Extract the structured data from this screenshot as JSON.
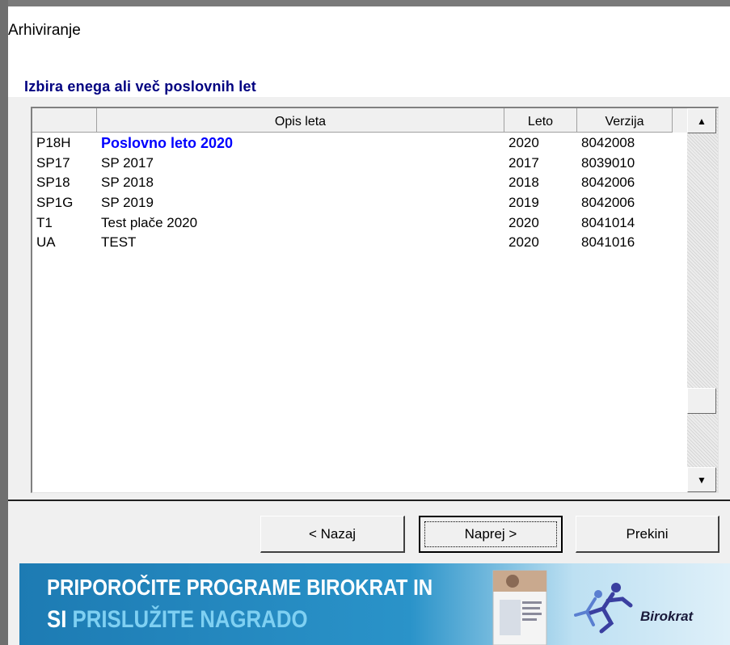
{
  "window": {
    "title": "Arhiviranje"
  },
  "section": {
    "title": "Izbira enega ali več poslovnih let"
  },
  "grid": {
    "columns": [
      "",
      "Opis leta",
      "Leto",
      "Verzija"
    ],
    "rows": [
      {
        "code": "P18H",
        "desc": "Poslovno leto 2020",
        "year": "2020",
        "version": "8042008",
        "highlighted": true
      },
      {
        "code": "SP17",
        "desc": "SP 2017",
        "year": "2017",
        "version": "8039010",
        "highlighted": false
      },
      {
        "code": "SP18",
        "desc": "SP 2018",
        "year": "2018",
        "version": "8042006",
        "highlighted": false
      },
      {
        "code": "SP1G",
        "desc": "SP 2019",
        "year": "2019",
        "version": "8042006",
        "highlighted": false
      },
      {
        "code": "T1",
        "desc": "Test plače 2020",
        "year": "2020",
        "version": "8041014",
        "highlighted": false
      },
      {
        "code": "UA",
        "desc": "TEST",
        "year": "2020",
        "version": "8041016",
        "highlighted": false
      }
    ],
    "highlight_color": "#0000ff"
  },
  "buttons": {
    "back": "< Nazaj",
    "next": "Naprej >",
    "cancel": "Prekini"
  },
  "banner": {
    "line1": "PRIPOROČITE PROGRAME BIROKRAT IN",
    "line2_prefix": "SI ",
    "line2_accent": "PRISLUŽITE NAGRADO",
    "brand": "Birokrat",
    "background_color": "#2a8fc4",
    "accent_color": "#7fd0f2"
  },
  "icons": {
    "scroll_up": "scroll-up-arrow-icon",
    "scroll_down": "scroll-down-arrow-icon"
  }
}
